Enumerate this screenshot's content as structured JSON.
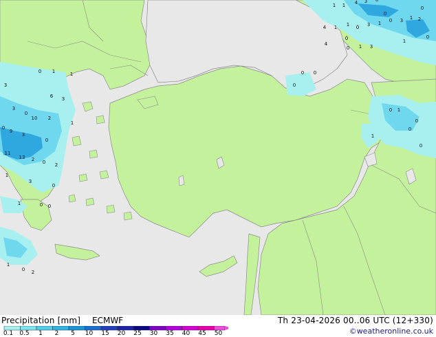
{
  "title": "Precipitation [mm]",
  "model": "ECMWF",
  "valid_time": "Th 23-04-2026 00..06 UTC (12+330)",
  "credit": "©weatheronline.co.uk",
  "legend": {
    "ticks": [
      "0.1",
      "0.5",
      "1",
      "2",
      "5",
      "10",
      "15",
      "20",
      "25",
      "30",
      "35",
      "40",
      "45",
      "50"
    ],
    "colors": [
      "#a8f0f0",
      "#7fe4f2",
      "#52cdea",
      "#2fb4e4",
      "#1c94d6",
      "#1a6fd0",
      "#2440c0",
      "#1a23a6",
      "#0a0a80",
      "#8000c8",
      "#b400e0",
      "#d400d4",
      "#e800b0",
      "#f04ae0"
    ]
  },
  "colors": {
    "sea": "#e8e8e8",
    "land": "#c4f29c",
    "border": "#8a8a8a",
    "precip_light": "#a8f0f0",
    "precip_medium": "#6fd8ee",
    "precip_heavy": "#2fa8e0"
  },
  "map_labels": {
    "west": [
      "3",
      "6",
      "3",
      "2",
      "1",
      "3",
      "0",
      "9",
      "3",
      "10",
      "0",
      "11",
      "13",
      "2",
      "0",
      "2",
      "1",
      "0",
      "1",
      "0",
      "3",
      "0",
      "0",
      "0",
      "1",
      "0",
      "2",
      "1",
      "1"
    ],
    "east": [
      "1",
      "1",
      "4",
      "3",
      "0",
      "4",
      "1",
      "1",
      "0",
      "3",
      "1",
      "0",
      "3",
      "1",
      "2",
      "4",
      "0",
      "1",
      "3",
      "1",
      "0",
      "1",
      "0",
      "0",
      "0",
      "0",
      "0",
      "0",
      "1",
      "0"
    ],
    "center": [
      "0",
      "0",
      "0"
    ]
  }
}
